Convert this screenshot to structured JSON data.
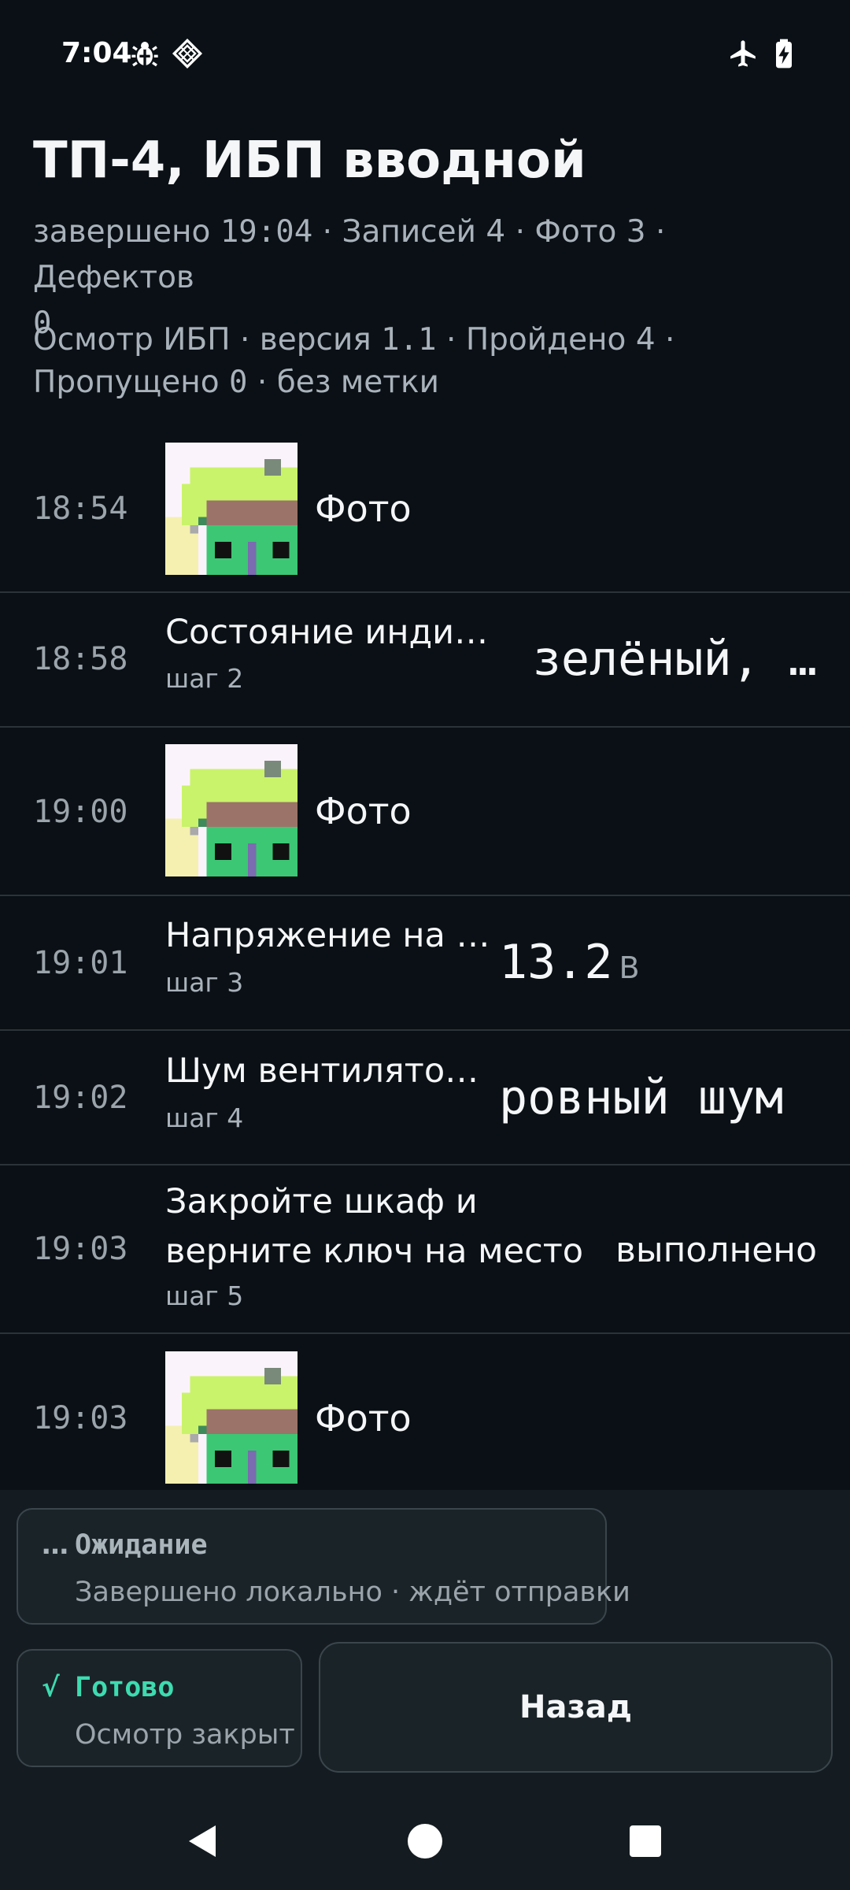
{
  "status_bar": {
    "time": "7:04",
    "left_icons": [
      "bug-icon",
      "vpn-icon"
    ],
    "right_icons": [
      "airplane-mode-icon",
      "battery-charging-icon"
    ]
  },
  "header": {
    "title": "ТП-4, ИБП вводной",
    "summary": {
      "completed_label": "завершено",
      "completed_time": "19:04",
      "sep": " · ",
      "records": "Записей 4",
      "photos": "Фото 3",
      "defects_label": "Дефектов",
      "defects_count": "0"
    },
    "template": {
      "name": "Осмотр ИБП",
      "version_label": "версия",
      "version": "1.1",
      "passed": "Пройдено 4",
      "skipped_label": "Пропущено",
      "skipped_count": "0",
      "tag": "без метки"
    }
  },
  "entries": [
    {
      "time": "18:54",
      "type": "photo",
      "label": "Фото",
      "icon": "photo-thumbnail"
    },
    {
      "time": "18:58",
      "type": "step",
      "title": "Состояние инди…",
      "step": "шаг 2",
      "value": "зелёный, …"
    },
    {
      "time": "19:00",
      "type": "photo",
      "label": "Фото",
      "icon": "photo-thumbnail"
    },
    {
      "time": "19:01",
      "type": "step",
      "title": "Напряжение на …",
      "step": "шаг 3",
      "value": "13.2",
      "unit": "В"
    },
    {
      "time": "19:02",
      "type": "step",
      "title": "Шум вентилято…",
      "step": "шаг 4",
      "value": "ровный шум"
    },
    {
      "time": "19:03",
      "type": "step",
      "title": "Закройте шкаф и верните ключ на место",
      "step": "шаг 5",
      "value": "выполнено"
    },
    {
      "time": "19:03",
      "type": "photo",
      "label": "Фото",
      "icon": "photo-thumbnail"
    }
  ],
  "sync_card": {
    "icon": "…",
    "title": "Ожидание",
    "subtitle": "Завершено локально · ждёт отправки",
    "color": "#aab4bb"
  },
  "done_card": {
    "icon": "√",
    "title": "Готово",
    "subtitle": "Осмотр закрыт",
    "color": "#3ddbb0"
  },
  "back_button": {
    "label": "Назад"
  },
  "nav_bar": {
    "icons": [
      "back-triangle-icon",
      "home-circle-icon",
      "recents-square-icon"
    ]
  }
}
